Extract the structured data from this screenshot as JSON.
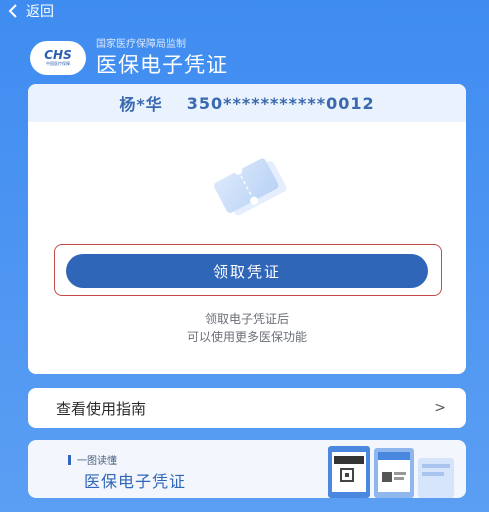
{
  "topbar": {
    "back_label": "返回"
  },
  "header": {
    "logo_text": "CHS",
    "logo_subtext": "中国医疗保障",
    "supervisor": "国家医疗保障局监制",
    "title": "医保电子凭证"
  },
  "card": {
    "user_name": "杨*华",
    "id_number": "350***********0012",
    "claim_button_label": "领取凭证",
    "hint_line1": "领取电子凭证后",
    "hint_line2": "可以使用更多医保功能"
  },
  "guide": {
    "label": "查看使用指南",
    "chevron": ">"
  },
  "banner": {
    "tag": "一图读懂",
    "title": "医保电子凭证"
  },
  "colors": {
    "accent": "#2f66b7",
    "highlight_border": "#c44a4a"
  }
}
